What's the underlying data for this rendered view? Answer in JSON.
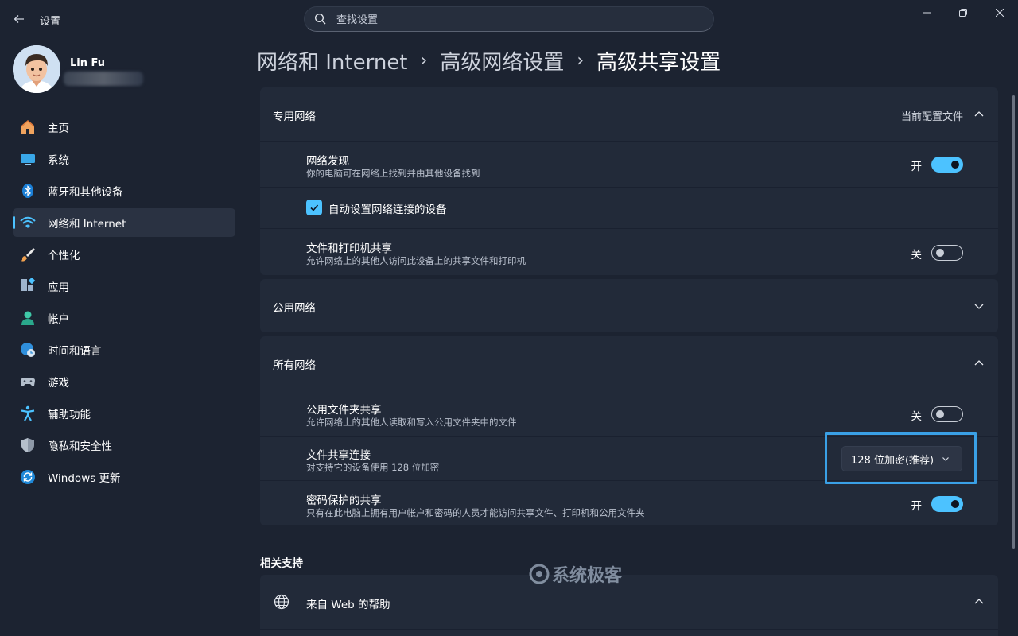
{
  "window": {
    "title": "设置",
    "search_placeholder": "查找设置"
  },
  "profile": {
    "name": "Lin Fu"
  },
  "nav": [
    {
      "label": "主页",
      "icon": "home-icon"
    },
    {
      "label": "系统",
      "icon": "system-icon"
    },
    {
      "label": "蓝牙和其他设备",
      "icon": "bluetooth-icon"
    },
    {
      "label": "网络和 Internet",
      "icon": "wifi-icon",
      "active": true
    },
    {
      "label": "个性化",
      "icon": "brush-icon"
    },
    {
      "label": "应用",
      "icon": "apps-icon"
    },
    {
      "label": "帐户",
      "icon": "account-icon"
    },
    {
      "label": "时间和语言",
      "icon": "globe-clock-icon"
    },
    {
      "label": "游戏",
      "icon": "gamepad-icon"
    },
    {
      "label": "辅助功能",
      "icon": "accessibility-icon"
    },
    {
      "label": "隐私和安全性",
      "icon": "shield-icon"
    },
    {
      "label": "Windows 更新",
      "icon": "update-icon"
    }
  ],
  "breadcrumb": [
    "网络和 Internet",
    "高级网络设置",
    "高级共享设置"
  ],
  "private": {
    "title": "专用网络",
    "current_profile": "当前配置文件",
    "discovery": {
      "title": "网络发现",
      "desc": "你的电脑可在网络上找到并由其他设备找到",
      "state": "开"
    },
    "auto_setup": {
      "label": "自动设置网络连接的设备"
    },
    "file_printer": {
      "title": "文件和打印机共享",
      "desc": "允许网络上的其他人访问此设备上的共享文件和打印机",
      "state": "关"
    }
  },
  "public": {
    "title": "公用网络"
  },
  "all": {
    "title": "所有网络",
    "public_folder": {
      "title": "公用文件夹共享",
      "desc": "允许网络上的其他人读取和写入公用文件夹中的文件",
      "state": "关"
    },
    "file_sharing": {
      "title": "文件共享连接",
      "desc": "对支持它的设备使用 128 位加密",
      "value": "128 位加密(推荐)"
    },
    "password": {
      "title": "密码保护的共享",
      "desc": "只有在此电脑上拥有用户帐户和密码的人员才能访问共享文件、打印机和公用文件夹",
      "state": "开"
    }
  },
  "related": {
    "title": "相关支持",
    "web_help": "来自 Web 的帮助"
  },
  "watermark": "系统极客",
  "colors": {
    "accent": "#4cc2ff",
    "background": "#1c2331",
    "card": "#222a39",
    "highlight": "#3aa0e6"
  }
}
